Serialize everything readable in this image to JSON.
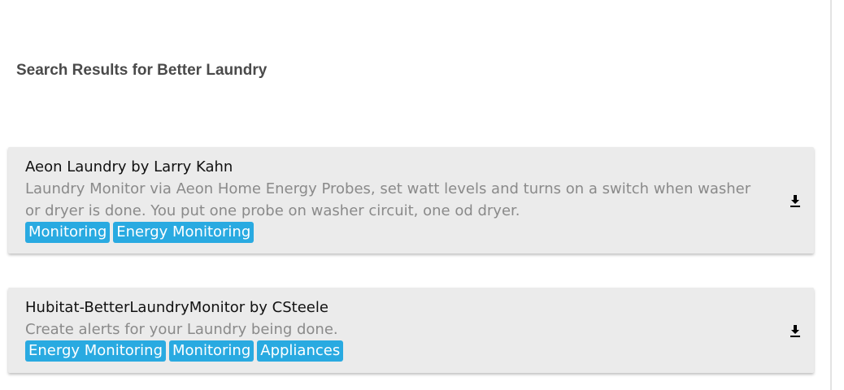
{
  "heading": "Search Results for Better Laundry",
  "results": [
    {
      "title": "Aeon Laundry by Larry Kahn",
      "description": "Laundry Monitor via Aeon Home Energy Probes, set watt levels and turns on a switch when washer or dryer is done. You put one probe on washer circuit, one od dryer.",
      "tags": [
        "Monitoring",
        "Energy Monitoring"
      ],
      "action_icon": "download-icon"
    },
    {
      "title": "Hubitat-BetterLaundryMonitor by CSteele",
      "description": "Create alerts for your Laundry being done.",
      "tags": [
        "Energy Monitoring",
        "Monitoring",
        "Appliances"
      ],
      "action_icon": "download-icon"
    }
  ],
  "colors": {
    "tag_background": "#29aae1",
    "card_background": "#ebebeb",
    "heading_text": "#4a4a4a",
    "description_text": "#8a8a8a"
  }
}
